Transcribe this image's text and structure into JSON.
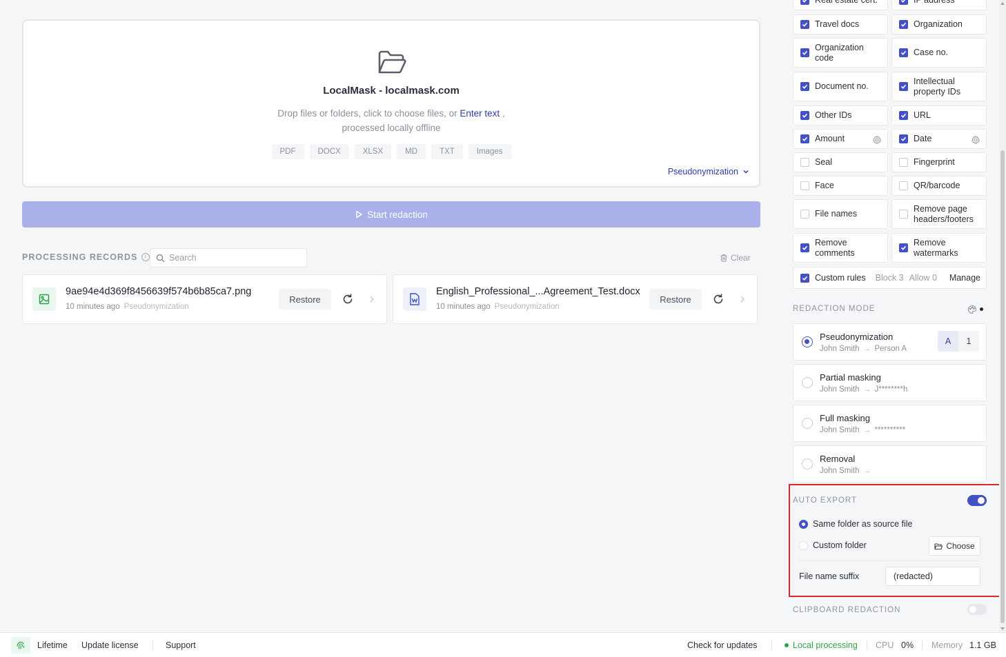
{
  "upload": {
    "title": "LocalMask - localmask.com",
    "desc_pre": "Drop files or folders, click to choose files, or",
    "desc_link": "Enter text",
    "desc_post": ",",
    "desc_line2": "processed locally offline",
    "formats": [
      "PDF",
      "DOCX",
      "XLSX",
      "MD",
      "TXT",
      "Images"
    ],
    "mode": "Pseudonymization",
    "icon": "folder-open-icon"
  },
  "start_button": {
    "label": "Start redaction",
    "color": "#a9b0ea"
  },
  "records": {
    "label": "PROCESSING RECORDS",
    "search_placeholder": "Search",
    "clear_label": "Clear",
    "items": [
      {
        "name": "9ae94e4d369f8456639f574b6b85ca7.png",
        "time": "10 minutes ago",
        "mode": "Pseudonymization",
        "restore": "Restore",
        "icon": "image-file-icon"
      },
      {
        "name": "English_Professional_...Agreement_Test.docx",
        "time": "10 minutes ago",
        "mode": "Pseudonymization",
        "restore": "Restore",
        "icon": "word-file-icon"
      }
    ]
  },
  "entities": [
    {
      "label": "Real estate cert.",
      "checked": true
    },
    {
      "label": "IP address",
      "checked": true
    },
    {
      "label": "Travel docs",
      "checked": true
    },
    {
      "label": "Organization",
      "checked": true
    },
    {
      "label": "Organization code",
      "checked": true
    },
    {
      "label": "Case no.",
      "checked": true
    },
    {
      "label": "Document no.",
      "checked": true
    },
    {
      "label": "Intellectual property IDs",
      "checked": true
    },
    {
      "label": "Other IDs",
      "checked": true
    },
    {
      "label": "URL",
      "checked": true
    },
    {
      "label": "Amount",
      "checked": true
    },
    {
      "label": "Date",
      "checked": true
    },
    {
      "label": "Seal",
      "checked": false
    },
    {
      "label": "Fingerprint",
      "checked": false
    },
    {
      "label": "Face",
      "checked": false
    },
    {
      "label": "QR/barcode",
      "checked": false
    },
    {
      "label": "File names",
      "checked": false
    },
    {
      "label": "Remove page headers/footers",
      "checked": false
    },
    {
      "label": "Remove comments",
      "checked": true
    },
    {
      "label": "Remove watermarks",
      "checked": true
    }
  ],
  "custom_rules": {
    "label": "Custom rules",
    "block": "Block 3",
    "allow": "Allow 0",
    "manage": "Manage",
    "checked": true
  },
  "redaction_mode": {
    "label": "REDACTION MODE",
    "selected": "pseudonymization",
    "options": [
      {
        "title": "Pseudonymization",
        "from": "John Smith",
        "to": "Person A",
        "seg": [
          "A",
          "1"
        ]
      },
      {
        "title": "Partial masking",
        "from": "John Smith",
        "to": "J********h"
      },
      {
        "title": "Full masking",
        "from": "John Smith",
        "to": "**********"
      },
      {
        "title": "Removal",
        "from": "John Smith",
        "to": ""
      }
    ]
  },
  "auto_export": {
    "label": "AUTO EXPORT",
    "enabled": true,
    "same_folder": "Same folder as source file",
    "custom_folder": "Custom folder",
    "choose": "Choose",
    "suffix_label": "File name suffix",
    "suffix_value": "(redacted)"
  },
  "clipboard": {
    "label": "CLIPBOARD REDACTION",
    "enabled": false
  },
  "footer": {
    "license": "Lifetime",
    "update_license": "Update license",
    "support": "Support",
    "check_updates": "Check for updates",
    "local_processing": "Local processing",
    "cpu_label": "CPU",
    "cpu_value": "0%",
    "memory_label": "Memory",
    "memory_value": "1.1 GB"
  },
  "colors": {
    "accent": "#4451c4",
    "link": "#2d3ca6",
    "success": "#2fa34a",
    "highlight": "#e0262a"
  }
}
